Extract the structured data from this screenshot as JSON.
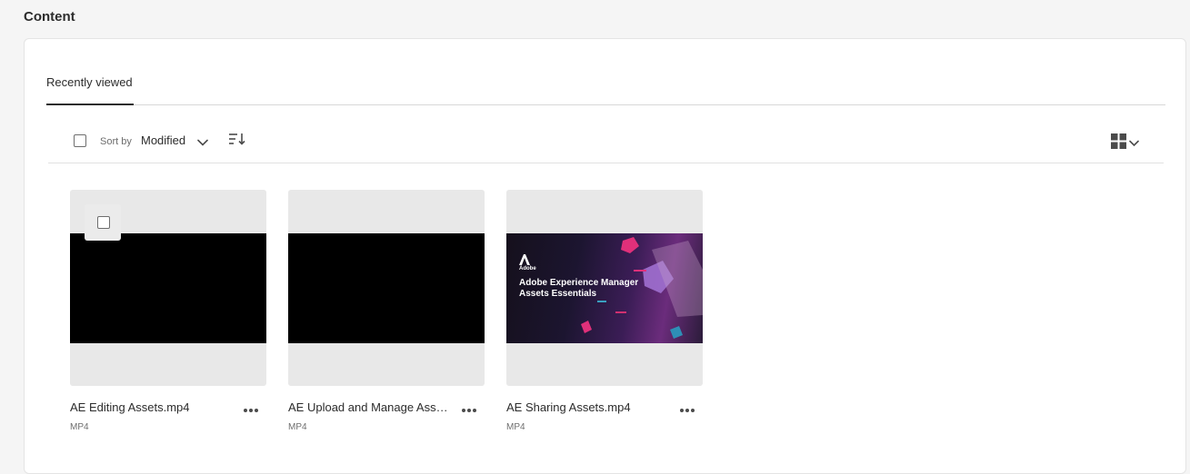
{
  "section": {
    "title": "Content"
  },
  "tabs": [
    {
      "label": "Recently viewed",
      "active": true
    }
  ],
  "toolbar": {
    "sort_by_label": "Sort by",
    "sort_field": "Modified",
    "sort_order_icon": "sort-descending-icon",
    "view_icon": "grid-view-icon"
  },
  "cards": [
    {
      "name": "AE Editing Assets.mp4",
      "type": "MP4",
      "thumbnail": "black-video-frame",
      "show_checkbox": true
    },
    {
      "name": "AE Upload and Manage Asse...",
      "type": "MP4",
      "thumbnail": "black-video-frame",
      "show_checkbox": false
    },
    {
      "name": "AE Sharing Assets.mp4",
      "type": "MP4",
      "thumbnail": "promo-frame",
      "show_checkbox": false,
      "thumbnail_text": {
        "brand": "Adobe",
        "title": "Adobe Experience Manager Assets Essentials"
      }
    }
  ],
  "colors": {
    "text": "#2c2c2c",
    "muted": "#6e6e6e",
    "thumb_bg": "#e8e8e8",
    "page_bg": "#f5f5f5"
  }
}
